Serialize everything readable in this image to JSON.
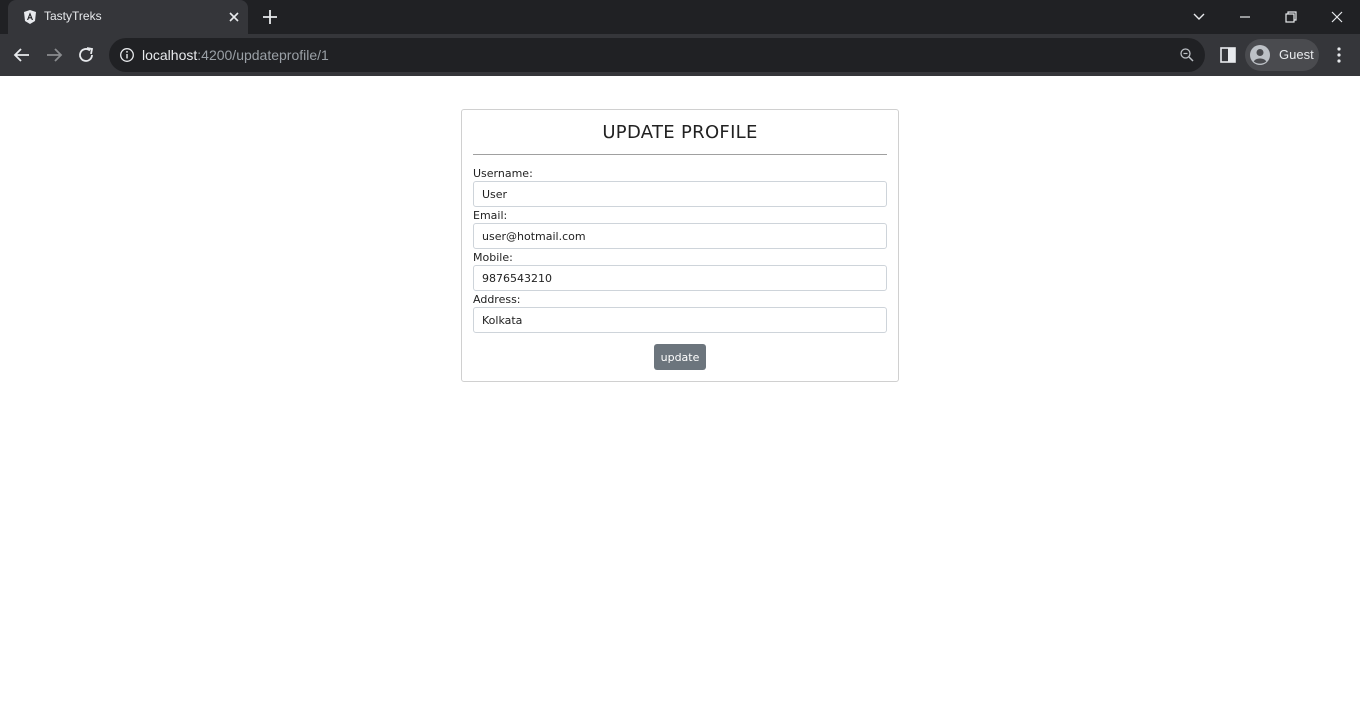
{
  "browser": {
    "tab": {
      "title": "TastyTreks"
    },
    "url": {
      "host": "localhost",
      "path": ":4200/updateprofile/1"
    },
    "profile_label": "Guest"
  },
  "form": {
    "title": "UPDATE PROFILE",
    "fields": [
      {
        "label": "Username:",
        "value": "User"
      },
      {
        "label": "Email:",
        "value": "user@hotmail.com"
      },
      {
        "label": "Mobile:",
        "value": "9876543210"
      },
      {
        "label": "Address:",
        "value": "Kolkata"
      }
    ],
    "submit_label": "update"
  },
  "icons": [
    "angular-icon",
    "close-icon",
    "plus-icon",
    "chevron-down-icon",
    "minimize-icon",
    "restore-icon",
    "close-window-icon",
    "back-arrow-icon",
    "forward-arrow-icon",
    "reload-icon",
    "info-icon",
    "zoom-icon",
    "side-panel-icon",
    "avatar-icon",
    "kebab-menu-icon"
  ]
}
